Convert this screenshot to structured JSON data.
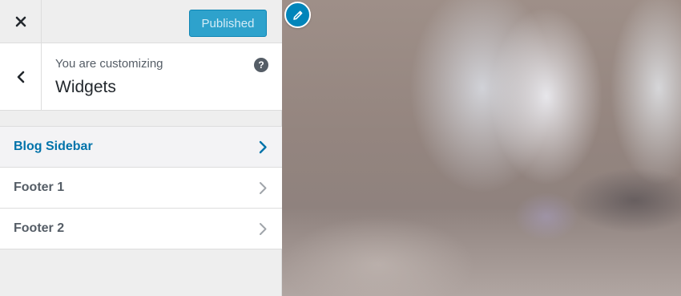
{
  "topbar": {
    "close_icon": "close-icon",
    "publish_label": "Published"
  },
  "section": {
    "back_icon": "chevron-left-icon",
    "customizing_label": "You are customizing",
    "title": "Widgets",
    "help_glyph": "?",
    "help_icon": "help-icon"
  },
  "items": [
    {
      "label": "Blog Sidebar",
      "active": true
    },
    {
      "label": "Footer 1",
      "active": false
    },
    {
      "label": "Footer 2",
      "active": false
    }
  ],
  "preview": {
    "shortcut_icon": "pencil-icon"
  },
  "colors": {
    "accent": "#0073aa",
    "publish_button": "#2ea2cc",
    "shortcut": "#0085ba",
    "panel_bg": "#eeeeee"
  }
}
